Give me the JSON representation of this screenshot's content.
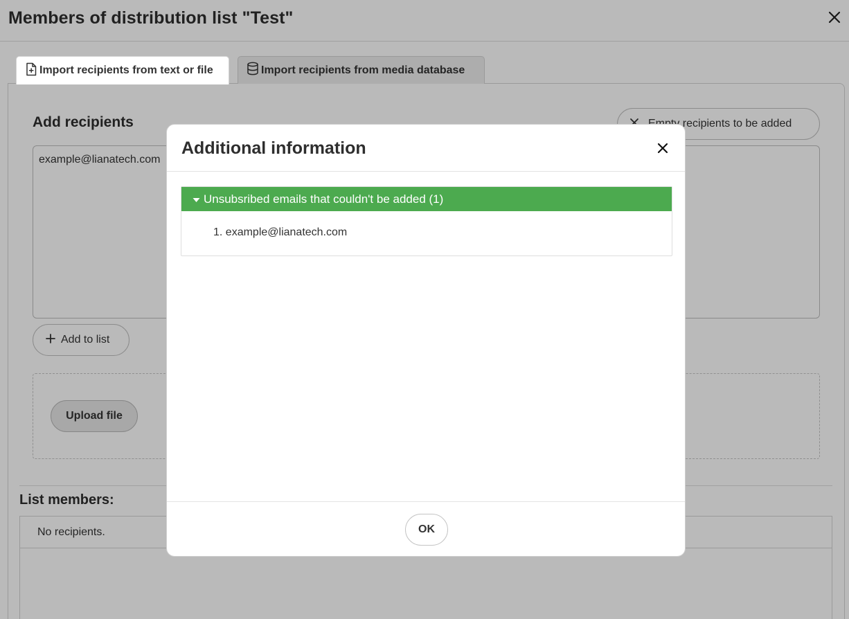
{
  "page": {
    "title": "Members of distribution list \"Test\""
  },
  "tabs": [
    {
      "label": "Import recipients from text or file",
      "icon": "file-plus-icon",
      "active": true
    },
    {
      "label": "Import recipients from media database",
      "icon": "database-icon",
      "active": false
    }
  ],
  "add_section": {
    "title": "Add recipients",
    "empty_button_label": "Empty recipients to be added",
    "textarea_value": "example@lianatech.com",
    "add_to_list_label": "Add to list",
    "upload_label": "Upload file"
  },
  "members": {
    "title": "List members:",
    "empty_text": "No recipients."
  },
  "modal": {
    "title": "Additional information",
    "accordion": {
      "header": "Unsubsribed emails that couldn't be added (1)",
      "items": [
        "1. example@lianatech.com"
      ]
    },
    "ok_label": "OK"
  },
  "colors": {
    "accordion_header": "#4caa4f",
    "overlay": "rgba(0,0,0,0.27)"
  }
}
